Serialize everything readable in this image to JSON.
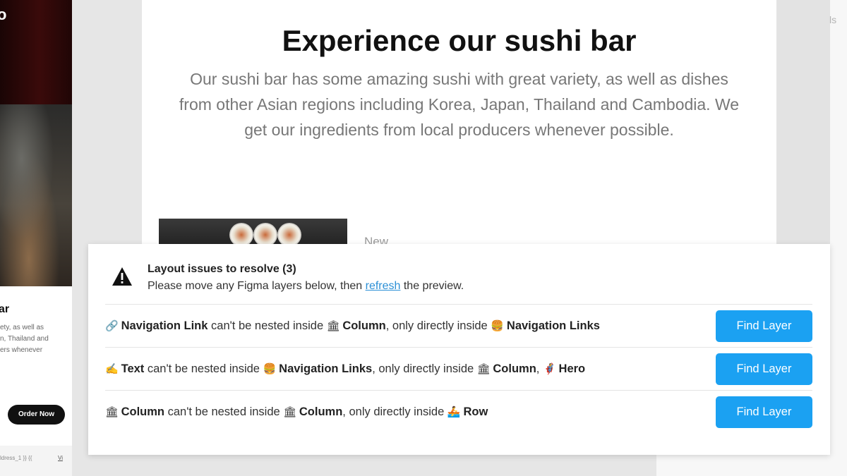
{
  "left_preview": {
    "logo": "o",
    "heading": "ar",
    "text": "ety, as well as\nn, Thailand and\ners whenever",
    "order_button": "Order Now",
    "footer_text": "ldress_1 }} {{",
    "footer_link": "Vi"
  },
  "right_panel": {
    "partial_label": "ls"
  },
  "main_preview": {
    "title": "Experience our sushi bar",
    "description": "Our sushi bar has some amazing sushi with great variety, as well as dishes from other Asian regions including Korea, Japan, Thailand and Cambodia. We get our ingredients from local producers whenever possible.",
    "new_label": "New"
  },
  "issues": {
    "title": "Layout issues to resolve (3)",
    "subtitle_before": "Please move any Figma layers below, then ",
    "subtitle_link": "refresh",
    "subtitle_after": " the preview.",
    "warning_icon": "warning-triangle-icon",
    "find_button_label": "Find Layer",
    "rows": [
      {
        "icon1": "🔗",
        "layer": "Navigation Link",
        "mid1": " can't be nested inside ",
        "icon2": "🏛",
        "parent": "Column",
        "mid2": ", only directly inside ",
        "icon3": "🍔",
        "allowed": "Navigation Links",
        "sep": "",
        "icon4": "",
        "allowed2": ""
      },
      {
        "icon1": "✍",
        "layer": "Text",
        "mid1": " can't be nested inside ",
        "icon2": "🍔",
        "parent": "Navigation Links",
        "mid2": ", only directly inside ",
        "icon3": "🏛",
        "allowed": "Column",
        "sep": ", ",
        "icon4": "🦸",
        "allowed2": "Hero"
      },
      {
        "icon1": "🏛",
        "layer": "Column",
        "mid1": " can't be nested inside ",
        "icon2": "🏛",
        "parent": "Column",
        "mid2": ", only directly inside ",
        "icon3": "🚣",
        "allowed": "Row",
        "sep": "",
        "icon4": "",
        "allowed2": ""
      }
    ]
  },
  "colors": {
    "accent": "#1ba1f2",
    "link": "#2a8fd6"
  }
}
